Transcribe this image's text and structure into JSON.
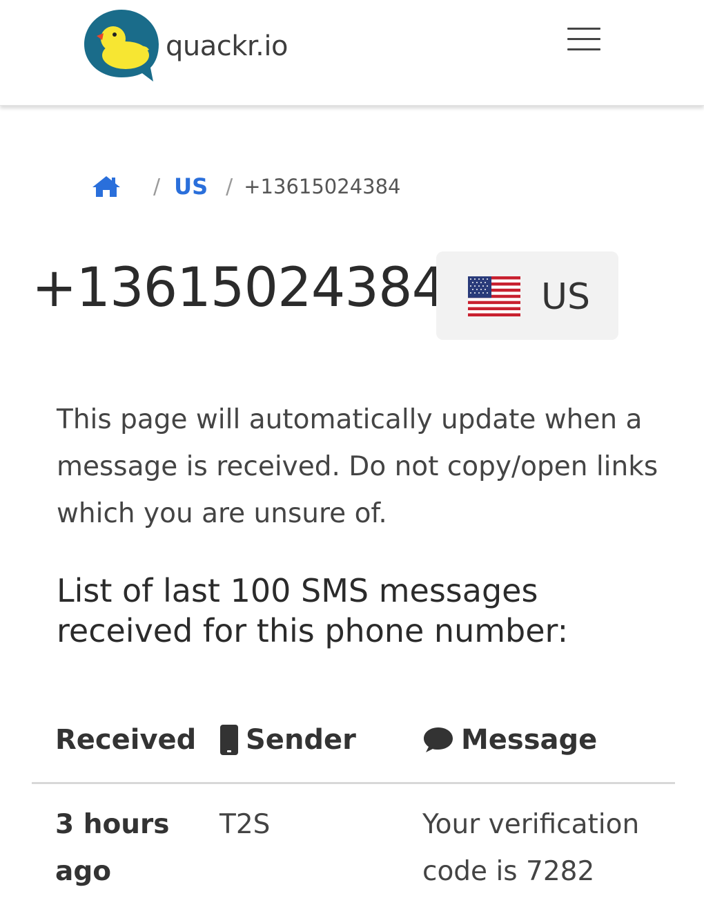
{
  "header": {
    "brand": "quackr.io",
    "logo_icon": "duck-chat-logo",
    "menu_icon": "hamburger-icon"
  },
  "breadcrumb": {
    "home_icon": "home-icon",
    "separator": "/",
    "country": "US",
    "current": "+13615024384"
  },
  "number": {
    "phone": "+13615024384",
    "country_code": "US",
    "flag_icon": "us-flag-icon"
  },
  "notice": "This page will automatically update when a message is received. Do not copy/open links which you are unsure of.",
  "list_heading": "List of last 100 SMS messages received for this phone number:",
  "table": {
    "columns": [
      {
        "label": "Received",
        "icon": ""
      },
      {
        "label": "Sender",
        "icon": "phone-icon"
      },
      {
        "label": "Message",
        "icon": "comment-icon"
      }
    ],
    "rows": [
      {
        "received": "3 hours ago",
        "sender": "T2S",
        "message": "Your verification code is 7282"
      }
    ]
  },
  "colors": {
    "link": "#2a6fdb",
    "logo_bg": "#1a6c8a",
    "duck": "#f7e632"
  }
}
